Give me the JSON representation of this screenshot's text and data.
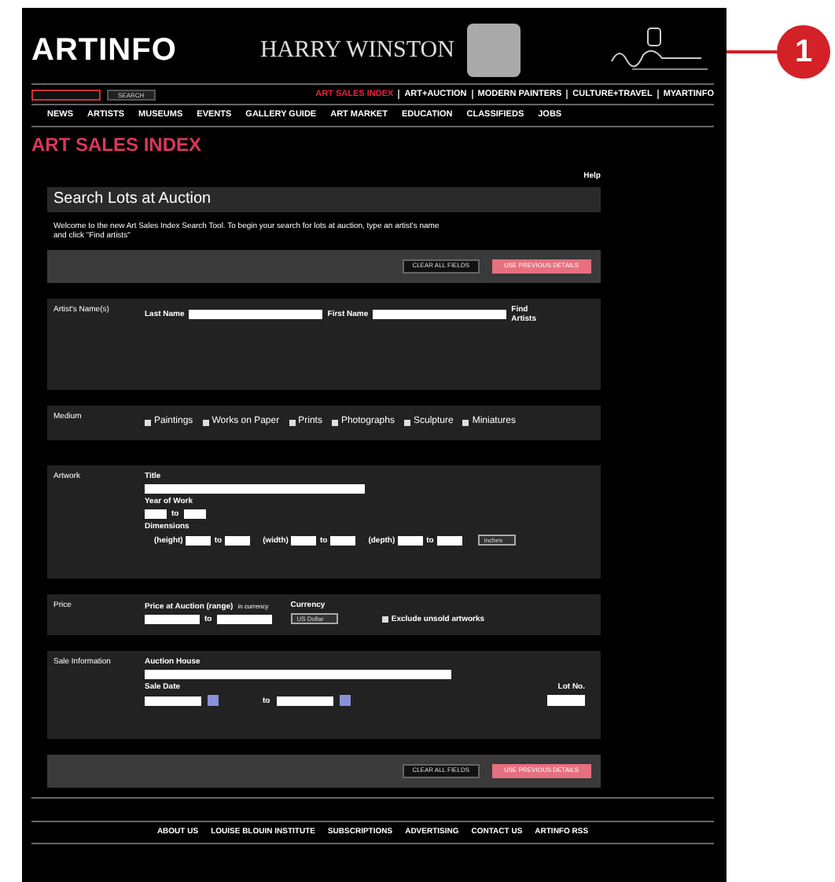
{
  "callout": {
    "number": "1"
  },
  "header": {
    "logo": "ARTINFO",
    "ad_text": "HARRY WINSTON"
  },
  "search": {
    "button": "SEARCH"
  },
  "top_nav": [
    {
      "label": "ART SALES INDEX",
      "selected": true
    },
    {
      "label": "ART+AUCTION",
      "selected": false
    },
    {
      "label": "MODERN PAINTERS",
      "selected": false
    },
    {
      "label": "CULTURE+TRAVEL",
      "selected": false
    },
    {
      "label": "MYARTINFO",
      "selected": false
    }
  ],
  "main_nav": [
    "NEWS",
    "ARTISTS",
    "MUSEUMS",
    "EVENTS",
    "GALLERY GUIDE",
    "ART MARKET",
    "EDUCATION",
    "CLASSIFIEDS",
    "JOBS"
  ],
  "page_title": "ART SALES INDEX",
  "help_link": "Help",
  "form_title": "Search Lots at Auction",
  "intro": "Welcome to the new Art Sales Index Search Tool. To begin your search for lots at auction, type an artist's name and click \"Find artists\"",
  "action_buttons": [
    {
      "label": "CLEAR ALL FIELDS",
      "kind": "secondary"
    },
    {
      "label": "USE PREVIOUS DETAILS",
      "kind": "primary"
    }
  ],
  "artist": {
    "label": "Artist's Name(s)",
    "last_name": "Last Name",
    "first_name": "First Name",
    "find": "Find Artists"
  },
  "medium": {
    "label": "Medium",
    "options": [
      {
        "label": "Paintings",
        "checked": false
      },
      {
        "label": "Works on Paper",
        "checked": false
      },
      {
        "label": "Prints",
        "checked": false
      },
      {
        "label": "Photographs",
        "checked": false
      },
      {
        "label": "Sculpture",
        "checked": false
      },
      {
        "label": "Miniatures",
        "checked": false
      }
    ]
  },
  "artwork": {
    "label": "Artwork",
    "title": "Title",
    "year": "Year of Work",
    "year_to": "to",
    "dimensions": "Dimensions",
    "dims": [
      {
        "label": "(height)",
        "to": "to"
      },
      {
        "label": "(width)",
        "to": "to"
      },
      {
        "label": "(depth)",
        "to": "to"
      }
    ],
    "unit": "inches"
  },
  "price": {
    "label": "Price",
    "range": "Price at Auction (range)",
    "range_note": "in currency",
    "to": "to",
    "currency": "Currency",
    "currency_value": "US Dollar",
    "exclude": {
      "label": "Exclude unsold artworks",
      "checked": false
    }
  },
  "sale": {
    "label": "Sale Information",
    "house": "Auction House",
    "date": "Sale Date",
    "date_to": "to",
    "lot": "Lot No."
  },
  "bottom_buttons": [
    {
      "label": "CLEAR ALL FIELDS",
      "kind": "secondary"
    },
    {
      "label": "USE PREVIOUS DETAILS",
      "kind": "primary"
    }
  ],
  "footer_nav": [
    "ABOUT US",
    "LOUISE BLOUIN INSTITUTE",
    "SUBSCRIPTIONS",
    "ADVERTISING",
    "CONTACT US",
    "ARTINFO RSS"
  ]
}
